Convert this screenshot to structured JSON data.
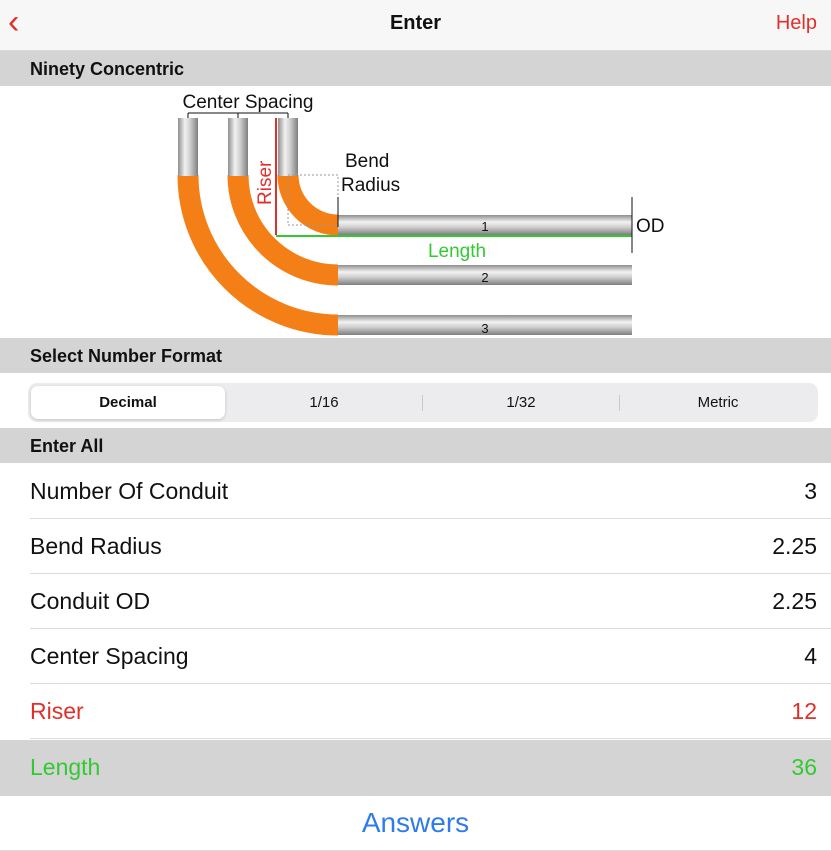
{
  "nav": {
    "back_icon": "chevron-left-icon",
    "title": "Enter",
    "help_label": "Help",
    "accent_color": "#e0302a"
  },
  "sections": {
    "diagram_header": "Ninety Concentric",
    "format_header": "Select Number Format",
    "enter_header": "Enter All"
  },
  "diagram": {
    "center_spacing_label": "Center Spacing",
    "riser_label": "Riser",
    "bend_label": "Bend",
    "radius_label": "Radius",
    "od_label": "OD",
    "length_label": "Length",
    "pipe_numbers": [
      "1",
      "2",
      "3"
    ],
    "bend_color": "#f57f17",
    "riser_color": "#e0302a",
    "length_color": "#34c934"
  },
  "number_format": {
    "options": [
      "Decimal",
      "1/16",
      "1/32",
      "Metric"
    ],
    "selected": "Decimal"
  },
  "fields": [
    {
      "label": "Number Of Conduit",
      "value": "3",
      "color": "#111111"
    },
    {
      "label": "Bend Radius",
      "value": "2.25",
      "color": "#111111"
    },
    {
      "label": "Conduit OD",
      "value": "2.25",
      "color": "#111111"
    },
    {
      "label": "Center Spacing",
      "value": "4",
      "color": "#111111"
    },
    {
      "label": "Riser",
      "value": "12",
      "color": "#e0302a"
    },
    {
      "label": "Length",
      "value": "36",
      "color": "#34c934",
      "selected": true
    }
  ],
  "answers_label": "Answers",
  "answers_color": "#2f7ce8"
}
